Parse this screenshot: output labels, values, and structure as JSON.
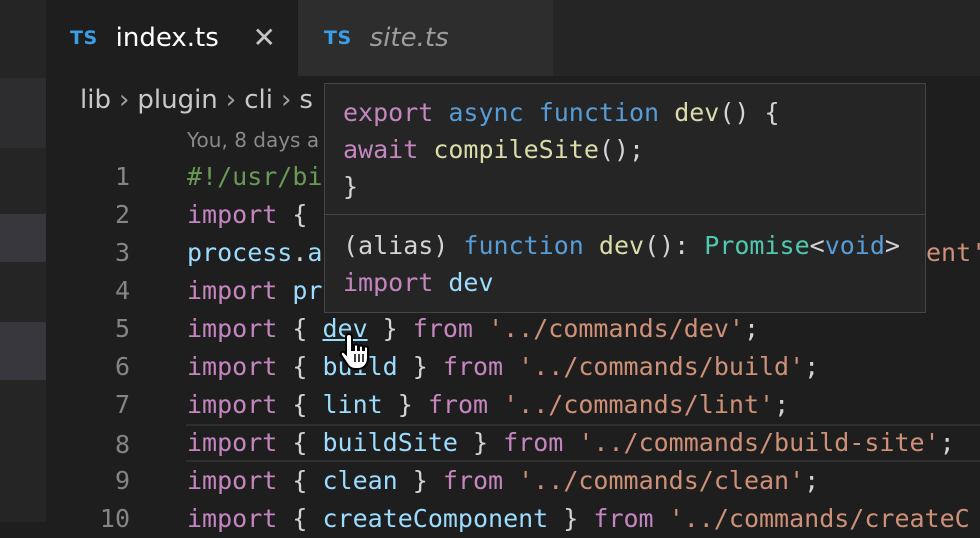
{
  "tabs": [
    {
      "badge": "TS",
      "label": "index.ts",
      "close": "✕"
    },
    {
      "badge": "TS",
      "label": "site.ts"
    }
  ],
  "breadcrumb": [
    "lib",
    "plugin",
    "cli",
    "s"
  ],
  "blame": "You, 8 days a",
  "lines": [
    {
      "n": "1",
      "t": [
        [
          "cm",
          "#!/usr/bi"
        ]
      ]
    },
    {
      "n": "2",
      "t": [
        [
          "kw",
          "import"
        ],
        [
          "pl",
          " {"
        ]
      ]
    },
    {
      "n": "3",
      "t": [
        [
          "var",
          "process"
        ],
        [
          "pl",
          "."
        ],
        [
          "var",
          "a"
        ]
      ],
      "tail": [
        [
          "str",
          "ent'"
        ]
      ]
    },
    {
      "n": "4",
      "t": [
        [
          "kw",
          "import"
        ],
        [
          "pl",
          " "
        ],
        [
          "var",
          "pr"
        ]
      ]
    },
    {
      "n": "5",
      "t": [
        [
          "kw",
          "import"
        ],
        [
          "pl",
          " { "
        ],
        [
          "link",
          "dev"
        ],
        [
          "pl",
          " } "
        ],
        [
          "kw",
          "from"
        ],
        [
          "pl",
          " "
        ],
        [
          "str",
          "'../commands/dev'"
        ],
        [
          "pl",
          ";"
        ]
      ]
    },
    {
      "n": "6",
      "t": [
        [
          "kw",
          "import"
        ],
        [
          "pl",
          " { "
        ],
        [
          "var",
          "build"
        ],
        [
          "pl",
          " } "
        ],
        [
          "kw",
          "from"
        ],
        [
          "pl",
          " "
        ],
        [
          "str",
          "'../commands/build'"
        ],
        [
          "pl",
          ";"
        ]
      ]
    },
    {
      "n": "7",
      "t": [
        [
          "kw",
          "import"
        ],
        [
          "pl",
          " { "
        ],
        [
          "var",
          "lint"
        ],
        [
          "pl",
          " } "
        ],
        [
          "kw",
          "from"
        ],
        [
          "pl",
          " "
        ],
        [
          "str",
          "'../commands/lint'"
        ],
        [
          "pl",
          ";"
        ]
      ]
    },
    {
      "n": "8",
      "t": [
        [
          "kw",
          "import"
        ],
        [
          "pl",
          " { "
        ],
        [
          "var",
          "buildSite"
        ],
        [
          "pl",
          " } "
        ],
        [
          "kw",
          "from"
        ],
        [
          "pl",
          " "
        ],
        [
          "str",
          "'../commands/build-site'"
        ],
        [
          "pl",
          ";"
        ]
      ],
      "current": true
    },
    {
      "n": "9",
      "t": [
        [
          "kw",
          "import"
        ],
        [
          "pl",
          " { "
        ],
        [
          "var",
          "clean"
        ],
        [
          "pl",
          " } "
        ],
        [
          "kw",
          "from"
        ],
        [
          "pl",
          " "
        ],
        [
          "str",
          "'../commands/clean'"
        ],
        [
          "pl",
          ";"
        ]
      ]
    },
    {
      "n": "10",
      "t": [
        [
          "kw",
          "import"
        ],
        [
          "pl",
          " { "
        ],
        [
          "var",
          "createComponent"
        ],
        [
          "pl",
          " } "
        ],
        [
          "kw",
          "from"
        ],
        [
          "pl",
          " "
        ],
        [
          "str",
          "'../commands/createC"
        ]
      ]
    }
  ],
  "hover": {
    "code": [
      [
        [
          "kw",
          "export"
        ],
        [
          "pl",
          " "
        ],
        [
          "kw-blue",
          "async"
        ],
        [
          "pl",
          " "
        ],
        [
          "kw-blue",
          "function"
        ],
        [
          "pl",
          " "
        ],
        [
          "fn",
          "dev"
        ],
        [
          "pl",
          "() {"
        ]
      ],
      [
        [
          "pl",
          "    "
        ],
        [
          "kw",
          "await"
        ],
        [
          "pl",
          " "
        ],
        [
          "fn",
          "compileSite"
        ],
        [
          "pl",
          "();"
        ]
      ],
      [
        [
          "pl",
          "}"
        ]
      ]
    ],
    "signature": [
      [
        [
          "pl",
          "(alias) "
        ],
        [
          "kw-blue",
          "function"
        ],
        [
          "pl",
          " "
        ],
        [
          "fn",
          "dev"
        ],
        [
          "pl",
          "(): "
        ],
        [
          "type",
          "Promise"
        ],
        [
          "pl",
          "<"
        ],
        [
          "kw-blue",
          "void"
        ],
        [
          "pl",
          ">"
        ]
      ],
      [
        [
          "kw",
          "import"
        ],
        [
          "pl",
          " "
        ],
        [
          "var",
          "dev"
        ]
      ]
    ]
  }
}
